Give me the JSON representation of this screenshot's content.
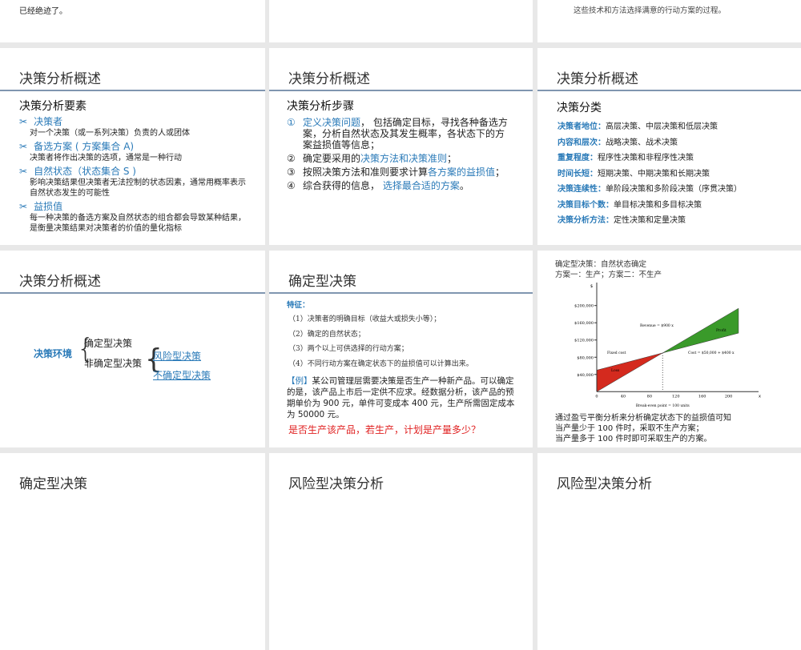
{
  "slides": {
    "s0a": {
      "text": "已经绝迹了。"
    },
    "s0c": {
      "text": "这些技术和方法选择满意的行动方案的过程。"
    },
    "s1": {
      "title": "决策分析概述",
      "subtitle": "决策分析要素",
      "items": [
        {
          "head": "决策者",
          "desc": "对一个决策（或一系列决策）负责的人或团体"
        },
        {
          "head": "备选方案 ( 方案集合 A)",
          "desc": "决策者将作出决策的选项，通常是一种行动"
        },
        {
          "head": "自然状态（状态集合 S )",
          "desc": "影响决策结果但决策者无法控制的状态因素，通常用概率表示自然状态发生的可能性"
        },
        {
          "head": "益损值",
          "desc": "每一种决策的备选方案及自然状态的组合都会导致某种结果，是衡量决策结果对决策者的价值的量化指标"
        }
      ]
    },
    "s2": {
      "title": "决策分析概述",
      "subtitle": "决策分析步骤",
      "steps": [
        {
          "num": "①",
          "a": "定义决策问题",
          "b": "， 包括确定目标，寻找各种备选方案，分析自然状态及其发生概率，各状态下的方案益损值等信息；",
          "c": ""
        },
        {
          "num": "②",
          "a": "",
          "b": "确定要采用的",
          "c": "决策方法和决策准则",
          "d": "；"
        },
        {
          "num": "③",
          "a": "",
          "b": "按照决策方法和准则要求计算",
          "c": "各方案的益损值",
          "d": "；"
        },
        {
          "num": "④",
          "a": "",
          "b": "综合获得的信息， ",
          "c": "选择最合适的方案",
          "d": "。"
        }
      ]
    },
    "s3": {
      "title": "决策分析概述",
      "subtitle": "决策分类",
      "rows": [
        {
          "k": "决策者地位：",
          "v": "高层决策、中层决策和低层决策"
        },
        {
          "k": "内容和层次：",
          "v": "战略决策、战术决策"
        },
        {
          "k": "重复程度：",
          "v": "程序性决策和非程序性决策"
        },
        {
          "k": "时间长短：",
          "v": "短期决策、中期决策和长期决策"
        },
        {
          "k": "决策连续性：",
          "v": "单阶段决策和多阶段决策（序贯决策）"
        },
        {
          "k": "决策目标个数：",
          "v": "单目标决策和多目标决策"
        },
        {
          "k": "决策分析方法：",
          "v": "定性决策和定量决策"
        }
      ]
    },
    "s4": {
      "title": "决策分析概述",
      "root": "决策环境",
      "a": "确定型决策",
      "b": "非确定型决策",
      "b1": "风险型决策",
      "b2": "不确定型决策"
    },
    "s5": {
      "title": "确定型决策",
      "feature": "特征：",
      "features": [
        "（1）决策者的明确目标（收益大或损失小等）；",
        "（2）确定的自然状态；",
        "（3）两个以上可供选择的行动方案；",
        "（4）不同行动方案在确定状态下的益损值可以计算出来。"
      ],
      "example_tag": "【例】",
      "example": "某公司管理层需要决策是否生产一种新产品。可以确定的是，该产品上市后一定供不应求。经数据分析，该产品的预期单价为 900 元，单件可变成本 400 元，生产所需固定成本为 50000 元。",
      "question": "是否生产该产品，若生产，计划是产量多少？"
    },
    "s6": {
      "line1": "确定型决策：自然状态确定",
      "line2": "方案一：生产；方案二：不生产",
      "conc": [
        "通过盈亏平衡分析来分析确定状态下的益损值可知",
        "当产量少于 100 件时，采取不生产方案；",
        "当产量多于 100 件时即可采取生产的方案。"
      ]
    },
    "s7": {
      "title": "确定型决策"
    },
    "s8": {
      "title": "风险型决策分析"
    },
    "s9": {
      "title": "风险型决策分析"
    }
  },
  "chart_data": {
    "type": "area",
    "xlabel": "x",
    "ylabel": "$",
    "xticks": [
      0,
      40,
      80,
      120,
      160,
      200
    ],
    "yticks": [
      "$40,000",
      "$80,000",
      "$120,000",
      "$160,000",
      "$200,000"
    ],
    "yvals": [
      40000,
      80000,
      120000,
      160000,
      200000
    ],
    "revenue_per_unit": 900,
    "fixed_cost": 50000,
    "variable_cost": 400,
    "xmax": 215,
    "labels": {
      "revenue": "Revenue = $900 x",
      "cost": "Cost = $50,000 + $400 x",
      "fixed": "Fixed cost",
      "loss": "Loss",
      "profit": "Profit",
      "breakeven": "Break-even point = 100 units"
    },
    "colors": {
      "loss": "#d42a1e",
      "profit": "#3a9a2a"
    }
  }
}
